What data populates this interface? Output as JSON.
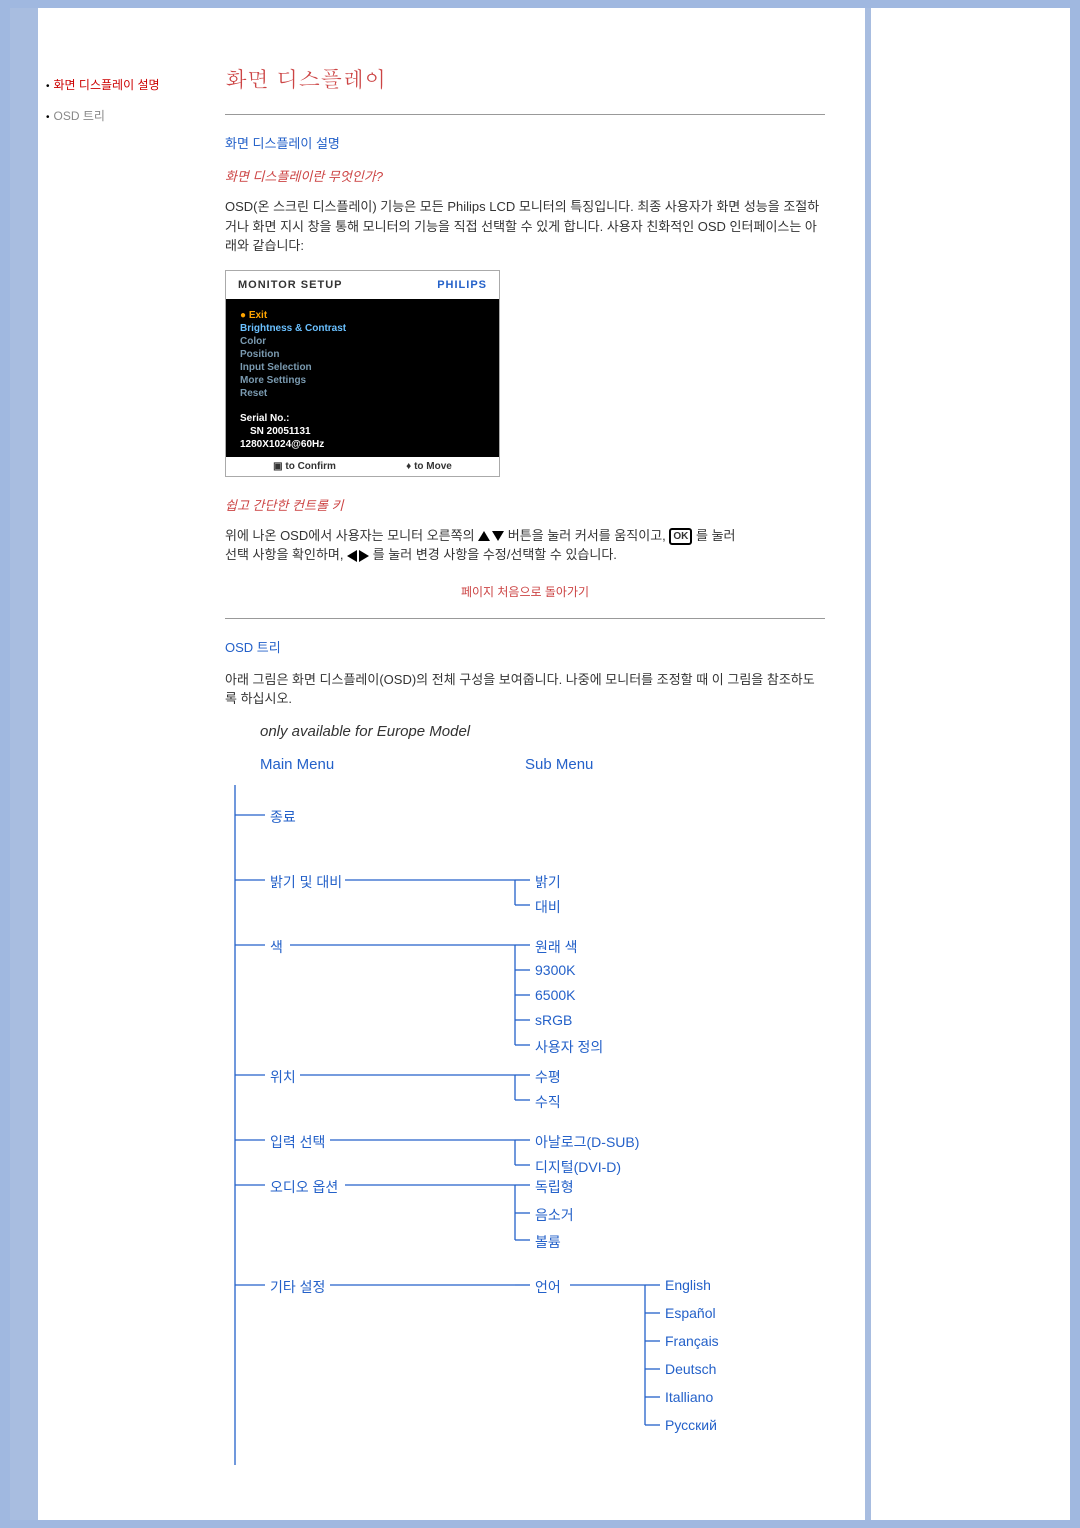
{
  "sidebar": {
    "link1": "화면 디스플레이 설명",
    "link2": "OSD 트리"
  },
  "title": "화면 디스플레이",
  "section1": {
    "heading": "화면 디스플레이 설명",
    "question": "화면 디스플레이란 무엇인가?",
    "paragraph": "OSD(온 스크린 디스플레이) 기능은 모든 Philips LCD 모니터의 특징입니다. 최종 사용자가 화면 성능을 조절하거나 화면 지시 창을 통해 모니터의 기능을 직접 선택할 수 있게 합니다. 사용자 친화적인 OSD 인터페이스는 아래와 같습니다:"
  },
  "osd": {
    "title": "MONITOR SETUP",
    "brand": "PHILIPS",
    "items": {
      "exit": "Exit",
      "brightness": "Brightness & Contrast",
      "color": "Color",
      "position": "Position",
      "input": "Input Selection",
      "more": "More Settings",
      "reset": "Reset"
    },
    "serial_label": "Serial No.:",
    "serial": "SN 20051131",
    "res": "1280X1024@60Hz",
    "foot_confirm": "to Confirm",
    "foot_move": "to Move"
  },
  "controls": {
    "heading": "쉽고 간단한 컨트롤 키",
    "line1a": "위에 나온 OSD에서 사용자는 모니터 오른쪽의 ",
    "line1b": " 버튼을 눌러 커서를 움직이고, ",
    "line1c": "를 눌러",
    "line2a": "선택 사항을 확인하며, ",
    "line2b": "를 눌러 변경 사항을 수정/선택할 수 있습니다.",
    "ok": "OK"
  },
  "backtop": "페이지 처음으로 돌아가기",
  "section2": {
    "heading": "OSD 트리",
    "paragraph": "아래 그림은 화면 디스플레이(OSD)의 전체 구성을 보여줍니다. 나중에 모니터를 조정할 때 이 그림을 참조하도록 하십시오.",
    "note": "only available for Europe Model",
    "mainmenu": "Main Menu",
    "submenu": "Sub Menu"
  },
  "tree": {
    "main": {
      "exit": "종료",
      "brightness": "밝기 및 대비",
      "color": "색",
      "position": "위치",
      "input": "입력 선택",
      "audio": "오디오 옵션",
      "more": "기타 설정"
    },
    "sub": {
      "bright": "밝기",
      "contrast": "대비",
      "origcolor": "원래 색",
      "k9300": "9300K",
      "k6500": "6500K",
      "srgb": "sRGB",
      "user": "사용자 정의",
      "horiz": "수평",
      "vert": "수직",
      "analog": "아날로그(D-SUB)",
      "digital": "디지털(DVI-D)",
      "standalone": "독립형",
      "mute": "음소거",
      "volume": "볼륨",
      "language": "언어"
    },
    "lang": {
      "en": "English",
      "es": "Español",
      "fr": "Français",
      "de": "Deutsch",
      "it": "Italliano",
      "ru": "Русский"
    }
  }
}
